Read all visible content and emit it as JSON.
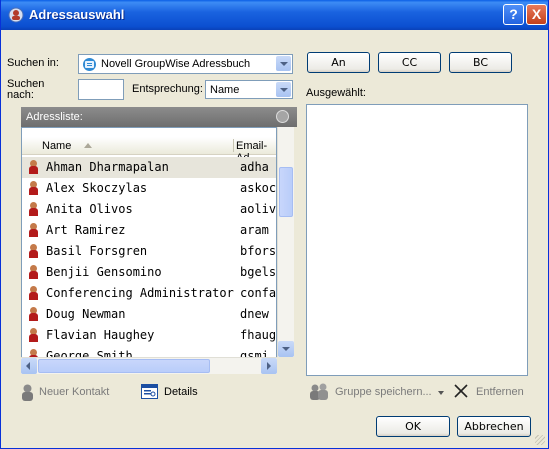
{
  "window": {
    "title": "Adressauswahl",
    "help_label": "?",
    "close_label": "X"
  },
  "search": {
    "search_in_label": "Suchen in:",
    "search_in_value": "Novell GroupWise Adressbuch",
    "search_for_label_1": "Suchen",
    "search_for_label_2": "nach:",
    "search_for_value": "",
    "match_label": "Entsprechung:",
    "match_value": "Name"
  },
  "address_list": {
    "label": "Adressliste:",
    "col_name": "Name",
    "col_email": "Email-Ad",
    "rows": [
      {
        "name": "Ahman Dharmapalan",
        "email": "adha"
      },
      {
        "name": "Alex Skoczylas",
        "email": "askoc"
      },
      {
        "name": "Anita Olivos",
        "email": "aoliv"
      },
      {
        "name": "Art Ramirez",
        "email": "aram"
      },
      {
        "name": "Basil Forsgren",
        "email": "bfors"
      },
      {
        "name": "Benjii Gensomino",
        "email": "bgels"
      },
      {
        "name": "Conferencing Administrator",
        "email": "confa"
      },
      {
        "name": "Doug Newman",
        "email": "dnew"
      },
      {
        "name": "Flavian Haughey",
        "email": "fhaug"
      },
      {
        "name": "George Smith",
        "email": "gsmi"
      }
    ]
  },
  "recipients": {
    "to_label": "An",
    "cc_label": "CC",
    "bc_label": "BC",
    "selected_label": "Ausgewählt:"
  },
  "actions": {
    "new_contact": "Neuer Kontakt",
    "details": "Details",
    "save_group": "Gruppe speichern...",
    "remove": "Entfernen",
    "ok": "OK",
    "cancel": "Abbrechen"
  },
  "colors": {
    "title_bar": "#0b4fd0",
    "dialog_bg": "#ece9d8",
    "list_header_bg": "#7a7a7a",
    "selected_row": "#e7e5db"
  }
}
